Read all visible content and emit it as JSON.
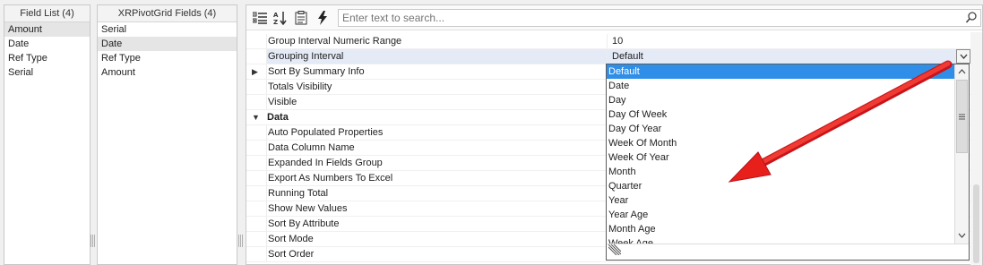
{
  "field_list": {
    "title": "Field List (4)",
    "items": [
      "Amount",
      "Date",
      "Ref Type",
      "Serial"
    ],
    "selected_index": 0
  },
  "xr_fields": {
    "title": "XRPivotGrid Fields (4)",
    "items": [
      "Serial",
      "Date",
      "Ref Type",
      "Amount"
    ],
    "selected_index": 1
  },
  "toolbar": {
    "icons": [
      "categorized-icon",
      "alphabetical-sort-icon",
      "property-pages-icon",
      "events-icon"
    ],
    "search_placeholder": "Enter text to search..."
  },
  "properties": [
    {
      "name": "Group Interval Numeric Range",
      "value": "10"
    },
    {
      "name": "Grouping Interval",
      "value": "Default",
      "highlighted": true,
      "dropdown": true
    },
    {
      "name": "Sort By Summary Info",
      "value": "",
      "expander": "collapsed"
    },
    {
      "name": "Totals Visibility",
      "value": ""
    },
    {
      "name": "Visible",
      "value": ""
    },
    {
      "name": "Data",
      "value": "",
      "category": true
    },
    {
      "name": "Auto Populated Properties",
      "value": ""
    },
    {
      "name": "Data Column Name",
      "value": ""
    },
    {
      "name": "Expanded In Fields Group",
      "value": ""
    },
    {
      "name": "Export As Numbers To Excel",
      "value": ""
    },
    {
      "name": "Running Total",
      "value": ""
    },
    {
      "name": "Show New Values",
      "value": ""
    },
    {
      "name": "Sort By Attribute",
      "value": ""
    },
    {
      "name": "Sort Mode",
      "value": ""
    },
    {
      "name": "Sort Order",
      "value": ""
    }
  ],
  "dropdown": {
    "options": [
      "Default",
      "Date",
      "Day",
      "Day Of Week",
      "Day Of Year",
      "Week Of Month",
      "Week Of Year",
      "Month",
      "Quarter",
      "Year",
      "Year Age",
      "Month Age",
      "Week Age"
    ],
    "selected_index": 0
  },
  "annotation": {
    "color": "#e8201c"
  }
}
